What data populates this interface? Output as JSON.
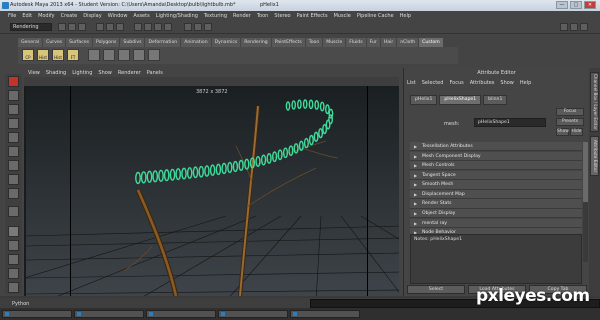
{
  "window": {
    "app_title": "Autodesk Maya 2013 x64 - Student Version: C:\\Users\\Amanda\\Desktop\\bulb\\lightbulb.mb*",
    "project_name": "pHelix1",
    "buttons": [
      "—",
      "▢",
      "✕"
    ]
  },
  "menubar": [
    "File",
    "Edit",
    "Modify",
    "Create",
    "Display",
    "Window",
    "Assets",
    "Lighting/Shading",
    "Texturing",
    "Render",
    "Toon",
    "Stereo",
    "Paint Effects",
    "Muscle",
    "Pipeline Cache",
    "Help"
  ],
  "statusline": {
    "menu_set": "Rendering"
  },
  "shelf": {
    "tabs": [
      "General",
      "Curves",
      "Surfaces",
      "Polygons",
      "Subdivs",
      "Deformation",
      "Animation",
      "Dynamics",
      "Rendering",
      "PaintEffects",
      "Toon",
      "Muscle",
      "Fluids",
      "Fur",
      "Hair",
      "nCloth",
      "Custom"
    ],
    "active_tab": "Custom",
    "icons": [
      "CP",
      "Hist",
      "Hist",
      "FT"
    ]
  },
  "viewport": {
    "menus": [
      "View",
      "Shading",
      "Lighting",
      "Show",
      "Renderer",
      "Panels"
    ],
    "resolution": "3872 x 3872",
    "helix_color": "#3ddc9a"
  },
  "attribute_editor": {
    "title": "Attribute Editor",
    "menu": [
      "List",
      "Selected",
      "Focus",
      "Attributes",
      "Show",
      "Help"
    ],
    "tabs": [
      "pHelix1",
      "pHelixShape1",
      "blinn1"
    ],
    "active_tab": "pHelixShape1",
    "side_buttons": {
      "focus": "Focus",
      "presets": "Presets",
      "show": "Show",
      "hide": "Hide"
    },
    "mesh_label": "mesh:",
    "mesh_value": "pHelixShape1",
    "sections": [
      "Tessellation Attributes",
      "Mesh Component Display",
      "Mesh Controls",
      "Tangent Space",
      "Smooth Mesh",
      "Displacement Map",
      "Render Stats",
      "Object Display",
      "mental ray",
      "Node Behavior"
    ],
    "notes": "Notes:  pHelixShape1",
    "buttons": [
      "Select",
      "Load Attributes",
      "Copy Tab"
    ]
  },
  "right_tabs": [
    "Channel Box / Layer Editor",
    "Attribute Editor"
  ],
  "command_line": {
    "label": "Python"
  },
  "watermark": "pxleyes.com"
}
